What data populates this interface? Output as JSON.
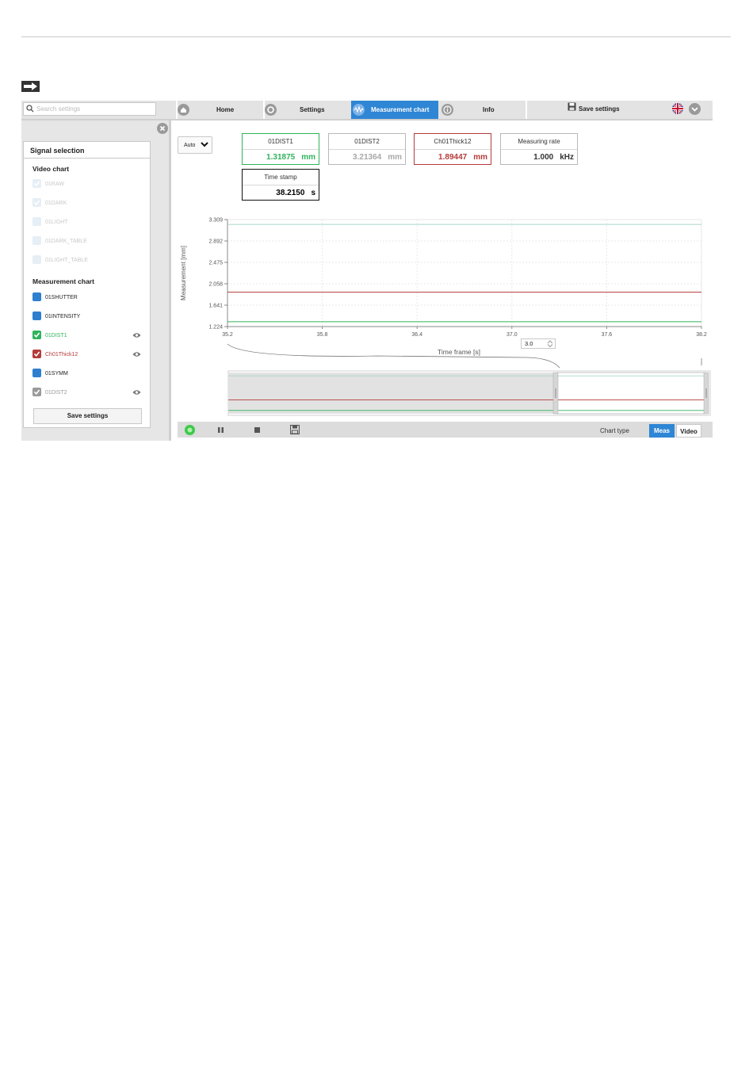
{
  "nav": {
    "search_placeholder": "Search settings",
    "home": "Home",
    "settings": "Settings",
    "measurement_chart": "Measurement chart",
    "info": "Info",
    "save_settings": "Save settings"
  },
  "sidebar": {
    "title": "Signal selection",
    "video_group": "Video chart",
    "video_signals": [
      {
        "label": "01RAW",
        "checked": true
      },
      {
        "label": "01DARK",
        "checked": true
      },
      {
        "label": "01LIGHT",
        "checked": false
      },
      {
        "label": "01DARK_TABLE",
        "checked": false
      },
      {
        "label": "01LIGHT_TABLE",
        "checked": false
      }
    ],
    "meas_group": "Measurement chart",
    "meas_signals": [
      {
        "label": "01SHUTTER",
        "color": "#2e7fcf",
        "checked": false,
        "eye": false
      },
      {
        "label": "01INTENSITY",
        "color": "#2e7fcf",
        "checked": false,
        "eye": false
      },
      {
        "label": "01DIST1",
        "color": "#2fb35c",
        "checked": true,
        "eye": true
      },
      {
        "label": "Ch01Thick12",
        "color": "#b53a3a",
        "checked": true,
        "eye": true
      },
      {
        "label": "01SYMM",
        "color": "#2e7fcf",
        "checked": false,
        "eye": false
      },
      {
        "label": "01DIST2",
        "color": "#9a9a9a",
        "checked": true,
        "eye": true
      }
    ],
    "save_button": "Save settings"
  },
  "toolbar": {
    "auto_select": "Auto"
  },
  "readouts": [
    {
      "name": "01DIST1",
      "value": "1.31875",
      "unit": "mm",
      "color": "#2fb35c"
    },
    {
      "name": "01DIST2",
      "value": "3.21364",
      "unit": "mm",
      "color": "#a8a8a8"
    },
    {
      "name": "Ch01Thick12",
      "value": "1.89447",
      "unit": "mm",
      "color": "#b53a3a"
    },
    {
      "name": "Measuring rate",
      "value": "1.000",
      "unit": "kHz",
      "color": "#333333"
    },
    {
      "name": "Time stamp",
      "value": "38.2150",
      "unit": "s",
      "color": "#000000"
    }
  ],
  "timeframe": {
    "value": "3.0",
    "label": "Time frame [s]"
  },
  "bottom": {
    "chart_type_label": "Chart type",
    "meas": "Meas",
    "video": "Video"
  },
  "chart_data": {
    "type": "line",
    "ylabel": "Measurement [mm]",
    "xlabel": "Time frame [s]",
    "x_ticks": [
      "35.2",
      "35.8",
      "36.4",
      "37.0",
      "37.6",
      "38.2"
    ],
    "y_ticks": [
      "3.309",
      "2.892",
      "2.475",
      "2.058",
      "1.641",
      "1.224"
    ],
    "xlim": [
      35.2,
      38.2
    ],
    "ylim": [
      1.224,
      3.309
    ],
    "series": [
      {
        "name": "01DIST2",
        "color": "#a8d4cc",
        "x": [
          35.2,
          38.2
        ],
        "y": [
          3.2136,
          3.2136
        ]
      },
      {
        "name": "Ch01Thick12",
        "color": "#b53a3a",
        "x": [
          35.2,
          38.2
        ],
        "y": [
          1.8945,
          1.8945
        ]
      },
      {
        "name": "01DIST1",
        "color": "#2fb35c",
        "x": [
          35.2,
          38.2
        ],
        "y": [
          1.3188,
          1.3188
        ]
      }
    ]
  }
}
